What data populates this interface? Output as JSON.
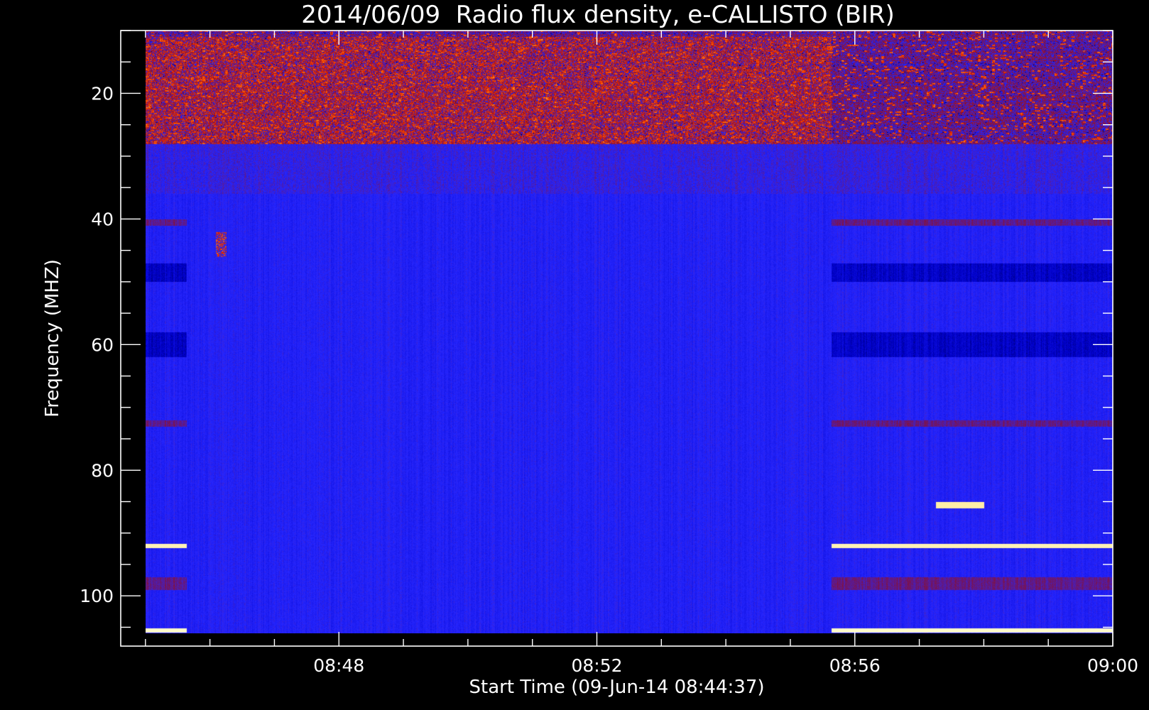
{
  "chart_data": {
    "type": "heatmap",
    "title": "2014/06/09  Radio flux density, e-CALLISTO (BIR)",
    "xlabel": "Start Time (09-Jun-14 08:44:37)",
    "ylabel": "Frequency (MHZ)",
    "x_axis": {
      "type": "time",
      "range": [
        "08:44:37",
        "09:00:00"
      ],
      "ticks": [
        {
          "value": "08:48",
          "label": "08:48"
        },
        {
          "value": "08:52",
          "label": "08:52"
        },
        {
          "value": "08:56",
          "label": "08:56"
        },
        {
          "value": "09:00",
          "label": "09:00"
        }
      ]
    },
    "y_axis": {
      "inverted": true,
      "range": [
        10,
        108
      ],
      "ticks": [
        20,
        40,
        60,
        80,
        100
      ]
    },
    "data_extent": {
      "time_start": "08:45:00",
      "time_end": "09:00:00",
      "freq_min": 10,
      "freq_max": 106
    },
    "data_gap": {
      "start": "08:45:38",
      "end": "08:55:38"
    },
    "colormap": [
      "#000000",
      "#0000c8",
      "#2626ff",
      "#8a1030",
      "#d21a0a",
      "#ff5a00",
      "#ffd040",
      "#ffffe0"
    ],
    "features": [
      {
        "type": "narrowband",
        "freq": 92,
        "time_start": "08:45:00",
        "time_end": "08:45:38",
        "level": 0.96
      },
      {
        "type": "narrowband",
        "freq": 92,
        "time_start": "08:55:38",
        "time_end": "09:00:00",
        "level": 0.96
      },
      {
        "type": "narrowband",
        "freq": 105.5,
        "time_start": "08:45:00",
        "time_end": "08:45:38",
        "level": 0.98
      },
      {
        "type": "narrowband",
        "freq": 105.5,
        "time_start": "08:55:38",
        "time_end": "09:00:00",
        "level": 0.98
      },
      {
        "type": "burst",
        "freq_start": 85,
        "freq_end": 86,
        "time_start": "08:57:15",
        "time_end": "08:58:00",
        "level": 0.95
      },
      {
        "type": "burst",
        "freq_start": 42,
        "freq_end": 46,
        "time_start": "08:46:05",
        "time_end": "08:46:15",
        "level": 0.75
      },
      {
        "type": "burst",
        "freq_start": 11,
        "freq_end": 28,
        "time_start": "08:45:00",
        "time_end": "08:55:38",
        "level": 0.7
      }
    ]
  }
}
